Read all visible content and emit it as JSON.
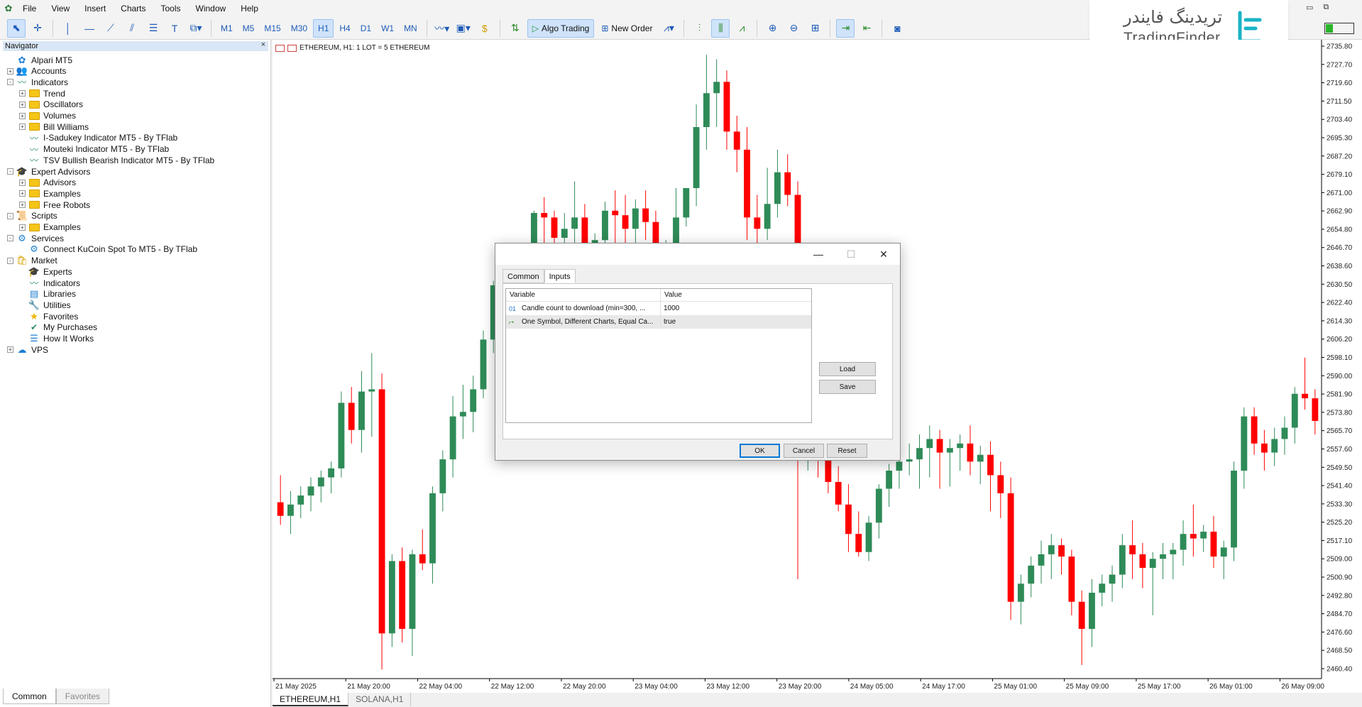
{
  "menu": [
    "File",
    "View",
    "Insert",
    "Charts",
    "Tools",
    "Window",
    "Help"
  ],
  "toolbar": {
    "timeframes": [
      "M1",
      "M5",
      "M15",
      "M30",
      "H1",
      "H4",
      "D1",
      "W1",
      "MN"
    ],
    "active_timeframe": "H1",
    "algo_trading": "Algo Trading",
    "new_order": "New Order"
  },
  "brand": {
    "name_fa": "تریدینگ فایندر",
    "name_en": "TradingFinder",
    "accent": "#19b3c7"
  },
  "navigator": {
    "title": "Navigator",
    "close": "×",
    "items": [
      {
        "label": "Alpari MT5",
        "icon": "terminal-icon",
        "level": 0,
        "exp": ""
      },
      {
        "label": "Accounts",
        "icon": "accounts-icon",
        "level": 1,
        "exp": "+"
      },
      {
        "label": "Indicators",
        "icon": "indicator-icon",
        "level": 1,
        "exp": "-"
      },
      {
        "label": "Trend",
        "icon": "folder-icon",
        "level": 2,
        "exp": "+"
      },
      {
        "label": "Oscillators",
        "icon": "folder-icon",
        "level": 2,
        "exp": "+"
      },
      {
        "label": "Volumes",
        "icon": "folder-icon",
        "level": 2,
        "exp": "+"
      },
      {
        "label": "Bill Williams",
        "icon": "folder-icon",
        "level": 2,
        "exp": "+"
      },
      {
        "label": "I-Sadukey Indicator MT5 - By TFlab",
        "icon": "indicator-icon",
        "level": 2,
        "exp": ""
      },
      {
        "label": "Mouteki Indicator MT5 - By TFlab",
        "icon": "indicator-icon",
        "level": 2,
        "exp": ""
      },
      {
        "label": "TSV Bullish Bearish Indicator MT5 - By TFlab",
        "icon": "indicator-icon",
        "level": 2,
        "exp": ""
      },
      {
        "label": "Expert Advisors",
        "icon": "expert-icon",
        "level": 1,
        "exp": "-"
      },
      {
        "label": "Advisors",
        "icon": "folder-icon",
        "level": 2,
        "exp": "+"
      },
      {
        "label": "Examples",
        "icon": "folder-icon",
        "level": 2,
        "exp": "+"
      },
      {
        "label": "Free Robots",
        "icon": "folder-icon",
        "level": 2,
        "exp": "+"
      },
      {
        "label": "Scripts",
        "icon": "script-icon",
        "level": 1,
        "exp": "-"
      },
      {
        "label": "Examples",
        "icon": "folder-icon",
        "level": 2,
        "exp": "+"
      },
      {
        "label": "Services",
        "icon": "services-icon",
        "level": 1,
        "exp": "-"
      },
      {
        "label": "Connect KuCoin Spot To MT5 - By TFlab",
        "icon": "service-gear-icon",
        "level": 2,
        "exp": ""
      },
      {
        "label": "Market",
        "icon": "market-icon",
        "level": 1,
        "exp": "-"
      },
      {
        "label": "Experts",
        "icon": "market-experts-icon",
        "level": 2,
        "exp": ""
      },
      {
        "label": "Indicators",
        "icon": "indicator-icon",
        "level": 2,
        "exp": ""
      },
      {
        "label": "Libraries",
        "icon": "library-icon",
        "level": 2,
        "exp": ""
      },
      {
        "label": "Utilities",
        "icon": "utilities-icon",
        "level": 2,
        "exp": ""
      },
      {
        "label": "Favorites",
        "icon": "star-icon",
        "level": 2,
        "exp": ""
      },
      {
        "label": "My Purchases",
        "icon": "purchases-icon",
        "level": 2,
        "exp": ""
      },
      {
        "label": "How It Works",
        "icon": "list-icon",
        "level": 2,
        "exp": ""
      },
      {
        "label": "VPS",
        "icon": "cloud-icon",
        "level": 0,
        "exp": "+"
      }
    ],
    "tabs": [
      "Common",
      "Favorites"
    ]
  },
  "chart": {
    "caption": "ETHEREUM, H1:  1 LOT = 5 ETHEREUM",
    "tabs": [
      "ETHEREUM,H1",
      "SOLANA,H1"
    ],
    "bull_color": "#2e8b57",
    "bear_color": "#ff0000"
  },
  "chart_data": {
    "type": "candlestick",
    "symbol": "ETHEREUM",
    "timeframe": "H1",
    "y_ticks": [
      "2735.80",
      "2727.70",
      "2719.60",
      "2711.50",
      "2703.40",
      "2695.30",
      "2687.20",
      "2679.10",
      "2671.00",
      "2662.90",
      "2654.80",
      "2646.70",
      "2638.60",
      "2630.50",
      "2622.40",
      "2614.30",
      "2606.20",
      "2598.10",
      "2590.00",
      "2581.90",
      "2573.80",
      "2565.70",
      "2557.60",
      "2549.50",
      "2541.40",
      "2533.30",
      "2525.20",
      "2517.10",
      "2509.00",
      "2500.90",
      "2492.80",
      "2484.70",
      "2476.60",
      "2468.50",
      "2460.40"
    ],
    "x_ticks": [
      "21 May 2025",
      "21 May 20:00",
      "22 May 04:00",
      "22 May 12:00",
      "22 May 20:00",
      "23 May 04:00",
      "23 May 12:00",
      "23 May 20:00",
      "24 May 05:00",
      "24 May 17:00",
      "25 May 01:00",
      "25 May 09:00",
      "25 May 17:00",
      "26 May 01:00",
      "26 May 09:00"
    ],
    "ylim": [
      2456,
      2738
    ],
    "candles": [
      [
        2534,
        2546,
        2524,
        2528
      ],
      [
        2528,
        2539,
        2520,
        2533
      ],
      [
        2533,
        2541,
        2527,
        2537
      ],
      [
        2537,
        2545,
        2530,
        2541
      ],
      [
        2541,
        2548,
        2534,
        2545
      ],
      [
        2545,
        2552,
        2538,
        2549
      ],
      [
        2549,
        2583,
        2545,
        2578
      ],
      [
        2578,
        2585,
        2560,
        2566
      ],
      [
        2566,
        2592,
        2556,
        2583
      ],
      [
        2583,
        2600,
        2563,
        2584
      ],
      [
        2584,
        2591,
        2460,
        2476
      ],
      [
        2476,
        2511,
        2470,
        2508
      ],
      [
        2508,
        2514,
        2472,
        2478
      ],
      [
        2478,
        2513,
        2466,
        2511
      ],
      [
        2511,
        2522,
        2504,
        2507
      ],
      [
        2507,
        2541,
        2498,
        2538
      ],
      [
        2538,
        2557,
        2530,
        2553
      ],
      [
        2553,
        2581,
        2545,
        2572
      ],
      [
        2572,
        2586,
        2562,
        2574
      ],
      [
        2574,
        2590,
        2565,
        2584
      ],
      [
        2584,
        2610,
        2580,
        2606
      ],
      [
        2606,
        2632,
        2600,
        2630
      ],
      [
        2630,
        2639,
        2605,
        2627
      ],
      [
        2627,
        2630,
        2610,
        2619
      ],
      [
        2619,
        2640,
        2612,
        2633
      ],
      [
        2633,
        2663,
        2625,
        2662
      ],
      [
        2662,
        2669,
        2645,
        2660
      ],
      [
        2660,
        2663,
        2638,
        2651
      ],
      [
        2651,
        2662,
        2634,
        2655
      ],
      [
        2655,
        2676,
        2640,
        2660
      ],
      [
        2660,
        2666,
        2638,
        2646
      ],
      [
        2646,
        2653,
        2638,
        2650
      ],
      [
        2650,
        2667,
        2640,
        2663
      ],
      [
        2663,
        2672,
        2648,
        2661
      ],
      [
        2661,
        2670,
        2646,
        2655
      ],
      [
        2655,
        2668,
        2648,
        2664
      ],
      [
        2664,
        2672,
        2650,
        2658
      ],
      [
        2658,
        2663,
        2634,
        2638
      ],
      [
        2638,
        2650,
        2620,
        2645
      ],
      [
        2645,
        2673,
        2638,
        2660
      ],
      [
        2660,
        2672,
        2656,
        2673
      ],
      [
        2673,
        2710,
        2665,
        2700
      ],
      [
        2700,
        2732,
        2690,
        2715
      ],
      [
        2715,
        2730,
        2700,
        2720
      ],
      [
        2720,
        2725,
        2690,
        2698
      ],
      [
        2698,
        2705,
        2680,
        2690
      ],
      [
        2690,
        2700,
        2650,
        2660
      ],
      [
        2660,
        2670,
        2640,
        2655
      ],
      [
        2655,
        2682,
        2650,
        2666
      ],
      [
        2666,
        2690,
        2660,
        2680
      ],
      [
        2680,
        2688,
        2665,
        2670
      ],
      [
        2670,
        2676,
        2500,
        2555
      ],
      [
        2555,
        2570,
        2548,
        2560
      ],
      [
        2560,
        2572,
        2545,
        2553
      ],
      [
        2553,
        2560,
        2538,
        2543
      ],
      [
        2543,
        2550,
        2530,
        2533
      ],
      [
        2533,
        2542,
        2512,
        2520
      ],
      [
        2520,
        2530,
        2510,
        2512
      ],
      [
        2512,
        2528,
        2508,
        2525
      ],
      [
        2525,
        2542,
        2518,
        2540
      ],
      [
        2540,
        2551,
        2532,
        2548
      ],
      [
        2548,
        2557,
        2540,
        2552
      ],
      [
        2552,
        2560,
        2546,
        2553
      ],
      [
        2553,
        2564,
        2540,
        2558
      ],
      [
        2558,
        2568,
        2545,
        2562
      ],
      [
        2562,
        2566,
        2540,
        2556
      ],
      [
        2556,
        2562,
        2541,
        2558
      ],
      [
        2558,
        2564,
        2548,
        2560
      ],
      [
        2560,
        2568,
        2546,
        2552
      ],
      [
        2552,
        2559,
        2542,
        2555
      ],
      [
        2555,
        2561,
        2530,
        2546
      ],
      [
        2546,
        2552,
        2527,
        2538
      ],
      [
        2538,
        2545,
        2482,
        2490
      ],
      [
        2490,
        2502,
        2480,
        2498
      ],
      [
        2498,
        2510,
        2492,
        2506
      ],
      [
        2506,
        2517,
        2498,
        2511
      ],
      [
        2511,
        2520,
        2500,
        2515
      ],
      [
        2515,
        2518,
        2502,
        2510
      ],
      [
        2510,
        2513,
        2484,
        2490
      ],
      [
        2490,
        2495,
        2462,
        2478
      ],
      [
        2478,
        2500,
        2470,
        2494
      ],
      [
        2494,
        2502,
        2488,
        2498
      ],
      [
        2498,
        2506,
        2490,
        2502
      ],
      [
        2502,
        2520,
        2496,
        2515
      ],
      [
        2515,
        2526,
        2500,
        2511
      ],
      [
        2511,
        2516,
        2496,
        2505
      ],
      [
        2505,
        2512,
        2484,
        2509
      ],
      [
        2509,
        2516,
        2500,
        2511
      ],
      [
        2511,
        2516,
        2500,
        2513
      ],
      [
        2513,
        2526,
        2506,
        2520
      ],
      [
        2520,
        2533,
        2510,
        2518
      ],
      [
        2518,
        2524,
        2512,
        2521
      ],
      [
        2521,
        2528,
        2505,
        2510
      ],
      [
        2510,
        2517,
        2500,
        2514
      ],
      [
        2514,
        2552,
        2508,
        2548
      ],
      [
        2548,
        2576,
        2540,
        2572
      ],
      [
        2572,
        2576,
        2555,
        2560
      ],
      [
        2560,
        2566,
        2548,
        2556
      ],
      [
        2556,
        2567,
        2550,
        2562
      ],
      [
        2562,
        2572,
        2555,
        2567
      ],
      [
        2567,
        2585,
        2560,
        2582
      ],
      [
        2582,
        2598,
        2575,
        2580
      ],
      [
        2580,
        2584,
        2564,
        2570
      ]
    ]
  },
  "dialog": {
    "minimize": "—",
    "maximize": "☐",
    "close": "✕",
    "tabs": [
      "Common",
      "Inputs"
    ],
    "active_tab": "Inputs",
    "columns": [
      "Variable",
      "Value"
    ],
    "rows": [
      {
        "icon": "01",
        "variable": "Candle count to download (min=300, ...",
        "value": "1000"
      },
      {
        "icon": "⮣",
        "variable": "One Symbol, Different Charts, Equal Ca...",
        "value": "true"
      }
    ],
    "load": "Load",
    "save": "Save",
    "ok": "OK",
    "cancel": "Cancel",
    "reset": "Reset"
  }
}
